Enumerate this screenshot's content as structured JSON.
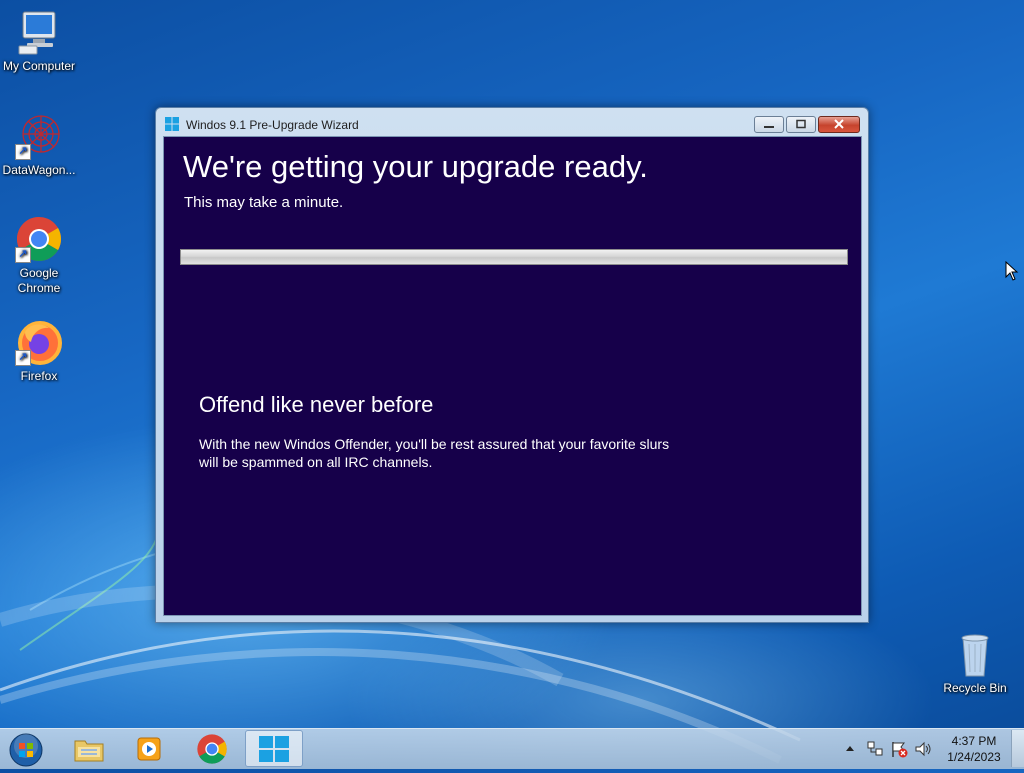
{
  "desktop": {
    "icons": [
      {
        "label": "My Computer"
      },
      {
        "label": "DataWagon..."
      },
      {
        "label": "Google Chrome"
      },
      {
        "label": "Firefox"
      }
    ],
    "recycle_bin": {
      "label": "Recycle Bin"
    }
  },
  "window": {
    "title": "Windos 9.1 Pre-Upgrade Wizard",
    "heading": "We're getting your upgrade ready.",
    "subheading": "This may take a minute.",
    "progress": 0,
    "feature_title": "Offend like never before",
    "feature_body": "With the new Windos Offender, you'll be rest assured that your favorite slurs will be spammed on all IRC channels.",
    "background_color": "#16004a"
  },
  "taskbar": {
    "items": [
      {
        "icon": "start-orb-icon"
      },
      {
        "icon": "file-explorer-icon"
      },
      {
        "icon": "media-player-icon"
      },
      {
        "icon": "chrome-icon"
      },
      {
        "icon": "windows-logo-icon"
      }
    ],
    "tray": {
      "time": "4:37 PM",
      "date": "1/24/2023"
    }
  }
}
